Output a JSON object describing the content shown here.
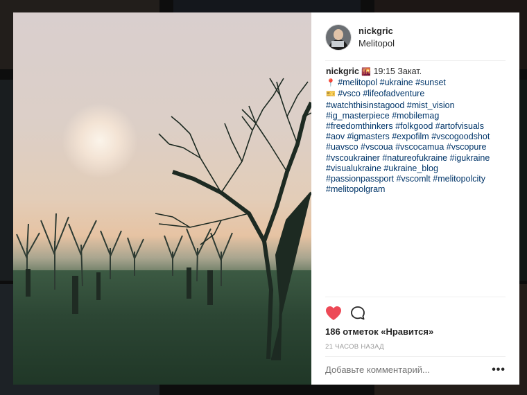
{
  "post": {
    "username": "nickgric",
    "location": "Melitopol",
    "caption_user": "nickgric",
    "caption_sunset_emoji": "🌇",
    "caption_text": " 19:15 Закат.",
    "pin_emoji": "📍",
    "ticket_emoji": "🎫",
    "caption_lines": [
      [
        "#melitopol",
        "#ukraine",
        "#sunset"
      ],
      [
        "#vsco",
        "#lifeofadventure"
      ],
      [
        "#watchthisinstagood",
        "#mist_vision"
      ],
      [
        "#ig_masterpiece",
        "#mobilemag"
      ],
      [
        "#freedomthinkers",
        "#folkgood",
        "#artofvisuals"
      ],
      [
        "#aov",
        "#igmasters",
        "#expofilm",
        "#vscogoodshot"
      ],
      [
        "#uavsco",
        "#vscoua",
        "#vscocamua",
        "#vscopure"
      ],
      [
        "#vscoukrainer",
        "#natureofukraine",
        "#igukraine"
      ],
      [
        "#visualukraine",
        "#ukraine_blog"
      ],
      [
        "#passionpassport",
        "#vscomlt",
        "#melitopolcity"
      ],
      [
        "#melitopolgram"
      ]
    ],
    "likes": "186 отметок «Нравится»",
    "time": "21 ЧАСОВ НАЗАД",
    "comment_placeholder": "Добавьте комментарий...",
    "more_label": "•••"
  },
  "icons": {
    "like": "heart-icon",
    "comment": "comment-icon",
    "more": "more-options-icon"
  },
  "colors": {
    "heart": "#ed4956",
    "hashtag": "#003569",
    "text": "#262626",
    "muted": "#999999"
  }
}
